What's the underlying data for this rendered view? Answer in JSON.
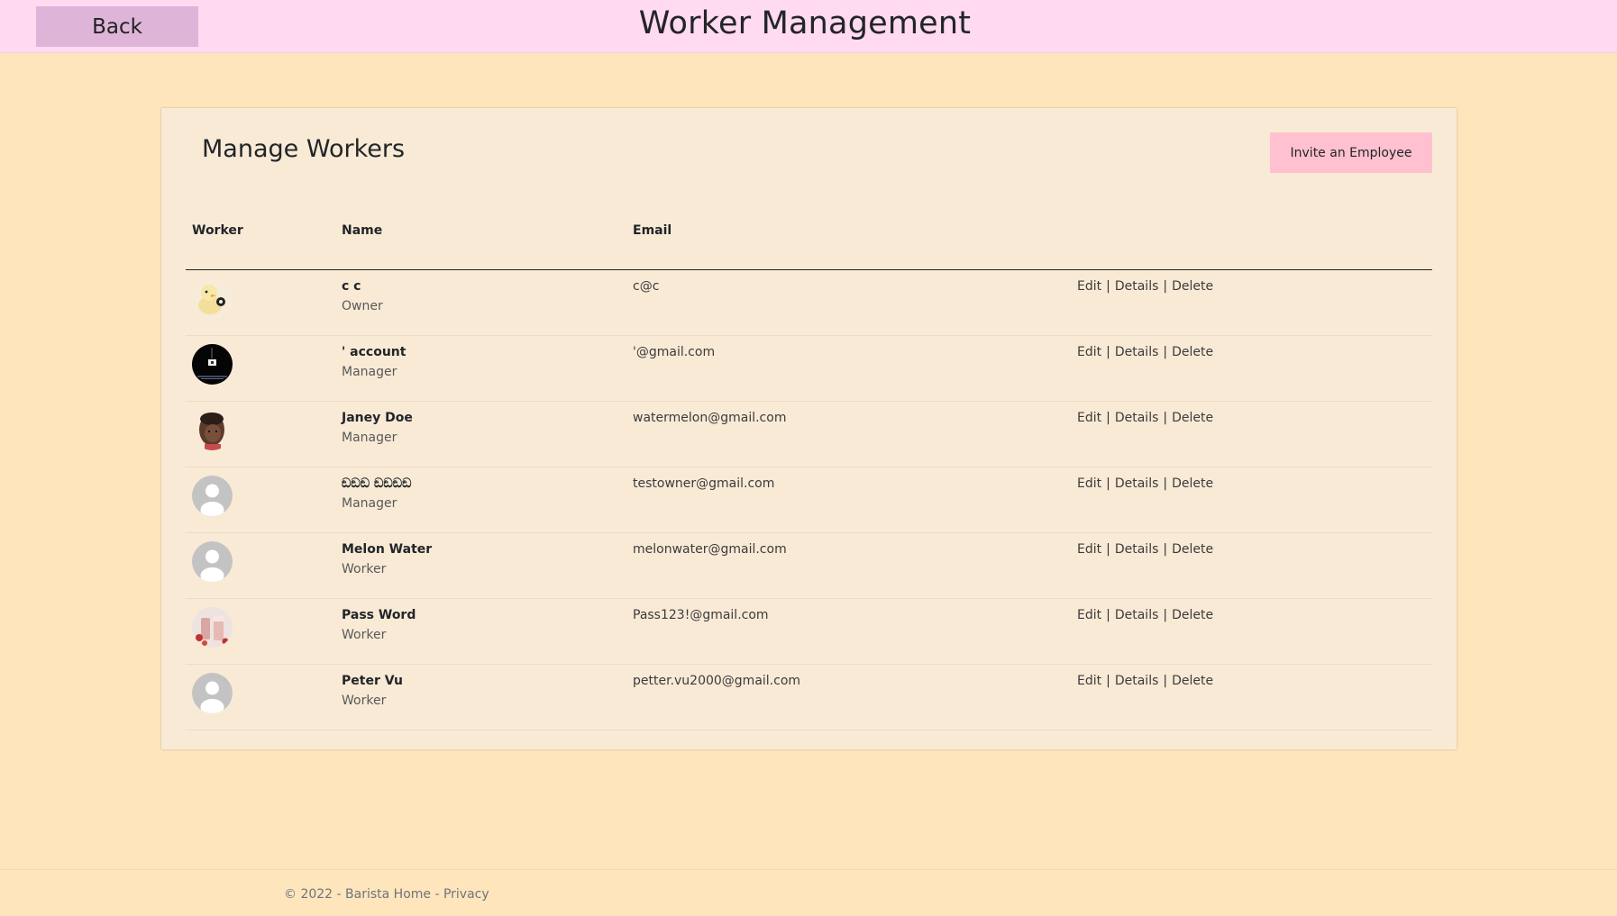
{
  "header": {
    "back_label": "Back",
    "title": "Worker Management"
  },
  "card": {
    "title": "Manage Workers",
    "invite_label": "Invite an Employee"
  },
  "table": {
    "headers": {
      "worker": "Worker",
      "name": "Name",
      "email": "Email"
    },
    "actions": {
      "edit": "Edit",
      "details": "Details",
      "delete": "Delete"
    },
    "rows": [
      {
        "name": "c c",
        "role": "Owner",
        "email": "c@c",
        "avatar": "duck-avatar-icon"
      },
      {
        "name": "' account",
        "role": "Manager",
        "email": "'@gmail.com",
        "avatar": "night-scene-avatar-icon"
      },
      {
        "name": "Janey Doe",
        "role": "Manager",
        "email": "watermelon@gmail.com",
        "avatar": "child-photo-avatar-icon"
      },
      {
        "name": "ඞඞඞ ඞඞඞඞ",
        "role": "Manager",
        "email": "testowner@gmail.com",
        "avatar": "default-user-avatar-icon"
      },
      {
        "name": "Melon Water",
        "role": "Worker",
        "email": "melonwater@gmail.com",
        "avatar": "default-user-avatar-icon"
      },
      {
        "name": "Pass Word",
        "role": "Worker",
        "email": "Pass123!@gmail.com",
        "avatar": "drinks-photo-avatar-icon"
      },
      {
        "name": "Peter Vu",
        "role": "Worker",
        "email": "petter.vu2000@gmail.com",
        "avatar": "default-user-avatar-icon"
      }
    ]
  },
  "footer": {
    "copyright": "© 2022 - Barista Home - ",
    "privacy": "Privacy"
  },
  "colors": {
    "page_bg": "#ffe5bc",
    "topbar_bg": "#ffdaf0",
    "back_button": "#deb5d8",
    "card_bg": "#f9ead6",
    "invite_button": "#ffc0cf"
  }
}
